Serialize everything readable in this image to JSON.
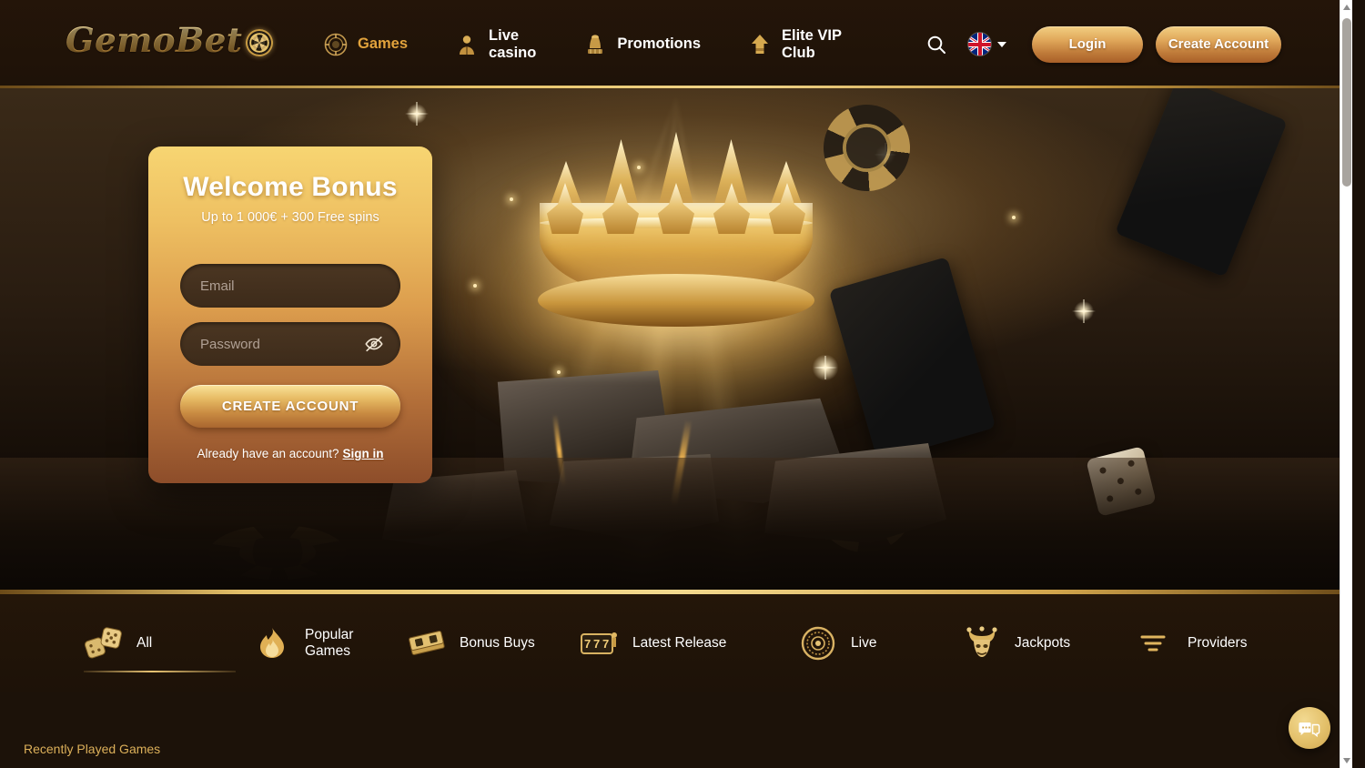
{
  "header": {
    "logo_text": "GemoBet",
    "logo_icon": "poker-chip-icon",
    "nav": [
      {
        "label": "Games",
        "icon": "casino-chip-icon",
        "active": true
      },
      {
        "label": "Live\ncasino",
        "icon": "live-dealer-icon",
        "active": false
      },
      {
        "label": "Promotions",
        "icon": "gift-fountain-icon",
        "active": false
      },
      {
        "label": "Elite VIP\nClub",
        "icon": "up-arrow-icon",
        "active": false
      }
    ],
    "search_icon": "search-icon",
    "language": {
      "code": "EN",
      "flag": "uk-flag-icon",
      "chevron": "chevron-down-icon"
    },
    "login_label": "Login",
    "create_account_label": "Create Account"
  },
  "bonus_card": {
    "title": "Welcome Bonus",
    "subtitle": "Up to 1 000€ + 300 Free spins",
    "email_placeholder": "Email",
    "email_value": "",
    "password_placeholder": "Password",
    "password_value": "",
    "password_toggle_icon": "eye-off-icon",
    "submit_label": "CREATE ACCOUNT",
    "signin_prompt": "Already have an account?",
    "signin_link": "Sign in"
  },
  "categories": [
    {
      "label": "All",
      "icon": "dice-icon",
      "active": true
    },
    {
      "label": "Popular\nGames",
      "icon": "flame-icon",
      "active": false
    },
    {
      "label": "Bonus Buys",
      "icon": "money-stack-icon",
      "active": false
    },
    {
      "label": "Latest Release",
      "icon": "slot-777-icon",
      "active": false
    },
    {
      "label": "Live",
      "icon": "roulette-wheel-icon",
      "active": false
    },
    {
      "label": "Jackpots",
      "icon": "jester-mask-icon",
      "active": false
    },
    {
      "label": "Providers",
      "icon": "filter-icon",
      "active": false
    }
  ],
  "sections": {
    "recently_played": "Recently Played Games"
  },
  "chat": {
    "icon": "chat-bubbles-icon"
  },
  "colors": {
    "gold": "#e8c46a",
    "gold_bright": "#f3d98e",
    "accent_amber": "#e2a33c",
    "bg_dark": "#1c1209",
    "card_top": "#f7d572",
    "card_bottom": "#8d4d2a",
    "field_bg": "#3d2b1a",
    "recent_text": "#dcb05a"
  },
  "scrollbar": {
    "position": "top"
  }
}
